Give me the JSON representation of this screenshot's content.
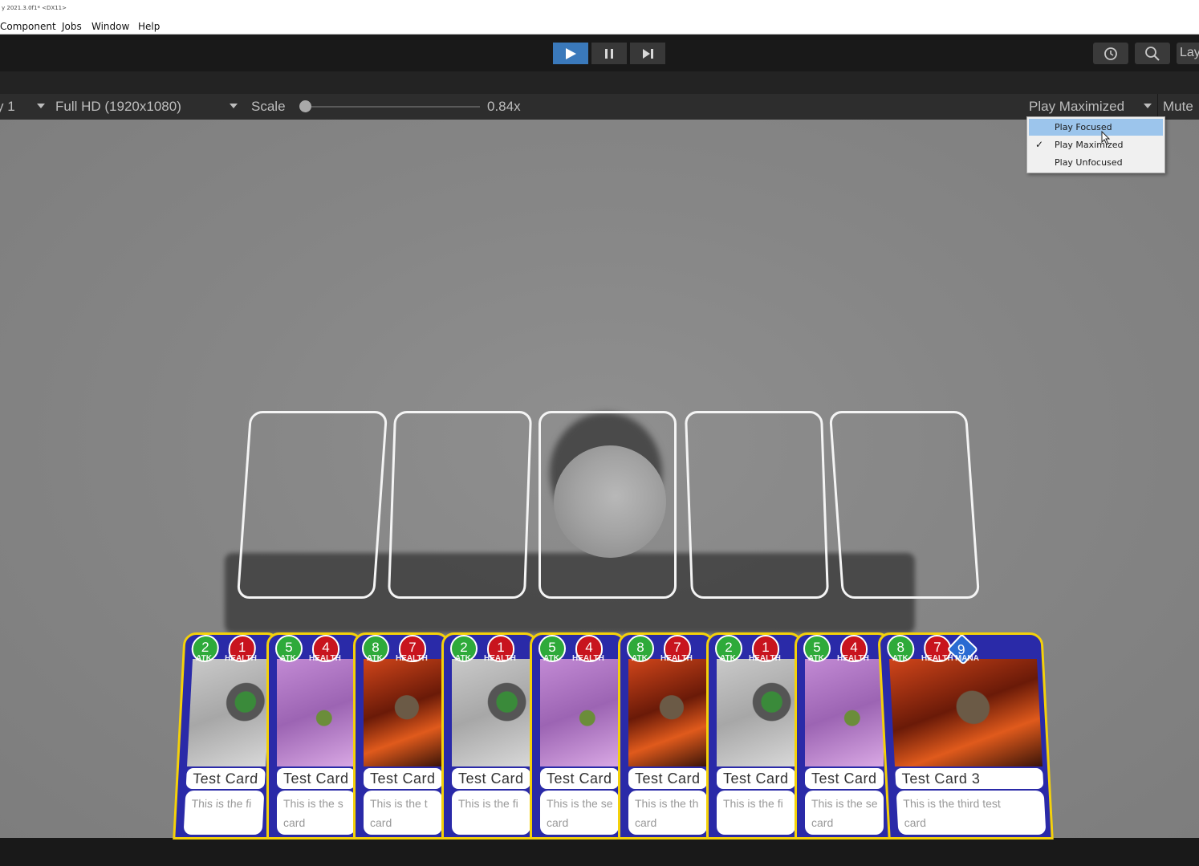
{
  "window": {
    "title": "y 2021.3.0f1* <DX11>"
  },
  "menu": {
    "items": [
      "Component",
      "Jobs",
      "Window",
      "Help"
    ]
  },
  "toolbar": {
    "play": "play-icon",
    "pause": "pause-icon",
    "step": "step-icon",
    "history": "history-icon",
    "search": "search-icon",
    "layout_label": "Lay"
  },
  "gameview": {
    "display": "y 1",
    "resolution": "Full HD (1920x1080)",
    "scale_label": "Scale",
    "scale_value": "0.84x",
    "play_mode": "Play Maximized",
    "mute": "Mute"
  },
  "dropdown": {
    "items": [
      {
        "label": "Play Focused",
        "checked": false,
        "highlighted": true
      },
      {
        "label": "Play Maximized",
        "checked": true,
        "highlighted": false
      },
      {
        "label": "Play Unfocused",
        "checked": false,
        "highlighted": false
      }
    ],
    "check": "✓"
  },
  "stat_labels": {
    "atk": "ATK",
    "health": "HEALTH",
    "mana": "MANA"
  },
  "cards": [
    {
      "atk": "2",
      "health": "1",
      "name": "Test Card",
      "desc1": "This is the fi",
      "desc2": "",
      "art": "grey"
    },
    {
      "atk": "5",
      "health": "4",
      "name": "Test Card",
      "desc1": "This is the s",
      "desc2": "card",
      "art": "purple"
    },
    {
      "atk": "8",
      "health": "7",
      "name": "Test Card",
      "desc1": "This is the t",
      "desc2": "card",
      "art": "fire"
    },
    {
      "atk": "2",
      "health": "1",
      "name": "Test Card",
      "desc1": "This is the fi",
      "desc2": "",
      "art": "grey"
    },
    {
      "atk": "5",
      "health": "4",
      "name": "Test Card",
      "desc1": "This is the se",
      "desc2": "card",
      "art": "purple"
    },
    {
      "atk": "8",
      "health": "7",
      "name": "Test Card",
      "desc1": "This is the th",
      "desc2": "card",
      "art": "fire"
    },
    {
      "atk": "2",
      "health": "1",
      "name": "Test Card",
      "desc1": "This is the fi",
      "desc2": "",
      "art": "grey"
    },
    {
      "atk": "5",
      "health": "4",
      "name": "Test Card",
      "desc1": "This is the se",
      "desc2": "card",
      "art": "purple"
    },
    {
      "atk": "8",
      "health": "7",
      "mana": "9",
      "name": "Test Card 3",
      "desc1": "This is the third test",
      "desc2": "card",
      "art": "fire"
    }
  ]
}
